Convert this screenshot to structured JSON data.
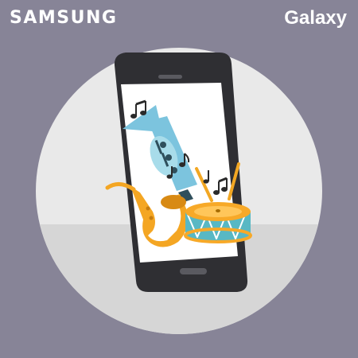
{
  "header": {
    "brand": "SAMSUNG",
    "product": "Galaxy"
  },
  "colors": {
    "background": "#878497",
    "circle": "#e9e9e9",
    "floor": "#d6d6d6",
    "phone_body": "#2f2f33",
    "screen": "#ffffff",
    "trumpet": "#7cc4de",
    "saxophone": "#f4a623",
    "drum_teal": "#58b8c4",
    "drum_orange": "#f7a928",
    "notes": "#2a2a2a"
  },
  "icons": [
    "music-note-icon",
    "trumpet-icon",
    "saxophone-icon",
    "drum-icon",
    "smartphone-icon"
  ]
}
